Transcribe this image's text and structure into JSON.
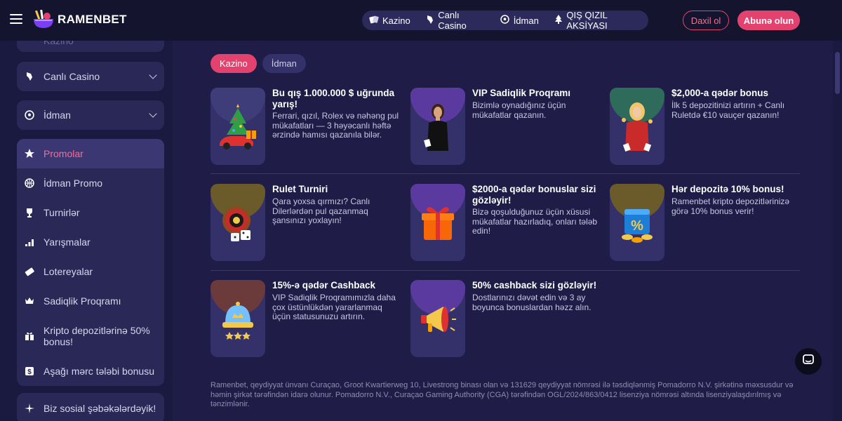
{
  "header": {
    "brand": "RAMENBET",
    "nav": [
      {
        "label": "Kazino",
        "icon": "cards-icon"
      },
      {
        "label": "Canlı Casino",
        "icon": "dealer-hand-icon"
      },
      {
        "label": "İdman",
        "icon": "soccer-ball-icon"
      },
      {
        "label": "QIŞ QIZIL AKSİYASI",
        "icon": "christmas-tree-icon"
      }
    ],
    "login_label": "Daxil ol",
    "signup_label": "Abunə olun",
    "accent": "#e4426e"
  },
  "sidebar": {
    "partial_top_label": "Kazino",
    "items": [
      {
        "label": "Canlı Casino",
        "icon": "dealer-hand-icon",
        "expandable": true
      },
      {
        "label": "İdman",
        "icon": "soccer-ball-icon",
        "expandable": true
      },
      {
        "label": "Promolar",
        "icon": "promo-star-icon",
        "active": true
      },
      {
        "label": "İdman Promo",
        "icon": "basketball-icon"
      },
      {
        "label": "Turnirlər",
        "icon": "trophy-icon"
      },
      {
        "label": "Yarışmalar",
        "icon": "bars-icon"
      },
      {
        "label": "Lotereyalar",
        "icon": "ticket-icon"
      },
      {
        "label": "Sadiqlik Proqramı",
        "icon": "crown-icon"
      },
      {
        "label": "Kripto depozitlərinə 50% bonus!",
        "icon": "gift-icon"
      },
      {
        "label": "Aşağı mərc tələbi bonusu",
        "icon": "dollar-icon"
      },
      {
        "label": "Biz sosial şəbəkələrdəyik!",
        "icon": "sparkle-icon"
      }
    ]
  },
  "filters": [
    {
      "label": "Kazino",
      "active": true
    },
    {
      "label": "İdman",
      "active": false
    }
  ],
  "promos": [
    {
      "title": "Bu qış 1.000.000 $ uğrunda yarış!",
      "desc": "Ferrari, qızıl, Rolex və nəhəng pul mükafatları — 3 həyəcanlı həftə ərzində hamısı qazanıla bilər.",
      "art": "christmas-car-art"
    },
    {
      "title": "VIP Sadiqlik Proqramı",
      "desc": "Bizimlə oynadığınız üçün mükafatlar qazanın.",
      "art": "vip-woman-art"
    },
    {
      "title": "$2,000-a qədər bonus",
      "desc": "İlk 5 depozitinizi artırın + Canlı Ruletdə €10 vauçer qazanın!",
      "art": "dealer-woman-art"
    },
    {
      "title": "Rulet Turniri",
      "desc": "Qara yoxsa qırmızı? Canlı Dilerlərdən pul qazanmaq şansınızı yoxlayın!",
      "art": "roulette-art"
    },
    {
      "title": "$2000-a qədər bonuslar sizi gözləyir!",
      "desc": "Bizə qoşulduğunuz üçün xüsusi mükafatlar hazırladıq, onları tələb edin!",
      "art": "gift-box-art"
    },
    {
      "title": "Hər depozitə 10% bonus!",
      "desc": "Ramenbet kripto depozitlərinizə görə 10% bonus verir!",
      "art": "percent-box-art"
    },
    {
      "title": "15%-ə qədər Cashback",
      "desc": "VIP Sadiqlik Proqramımızla daha çox üstünlükdən yararlanmaq üçün statusunuzu artırın.",
      "art": "crown-bell-art"
    },
    {
      "title": "50% cashback sizi gözləyir!",
      "desc": "Dostlarınızı dəvət edin və 3 ay boyunca bonuslardan həzz alın.",
      "art": "megaphone-art"
    }
  ],
  "footer": {
    "text": "Ramenbet, qeydiyyat ünvanı Curaçao, Groot Kwartierweg 10, Livestrong binası olan və 131629 qeydiyyat nömrəsi ilə təsdiqlənmiş Pomadorro N.V. şirkətinə məxsusdur və həmin şirkət tərəfindən idarə olunur. Pomadorro N.V., Curaçao Gaming Authority (CGA) tərəfindən OGL/2024/863/0412 lisenziya nömrəsi altında lisenziyalaşdırılmış və tənzimlənir."
  },
  "chat": {
    "icon": "chat-bubble-icon"
  }
}
